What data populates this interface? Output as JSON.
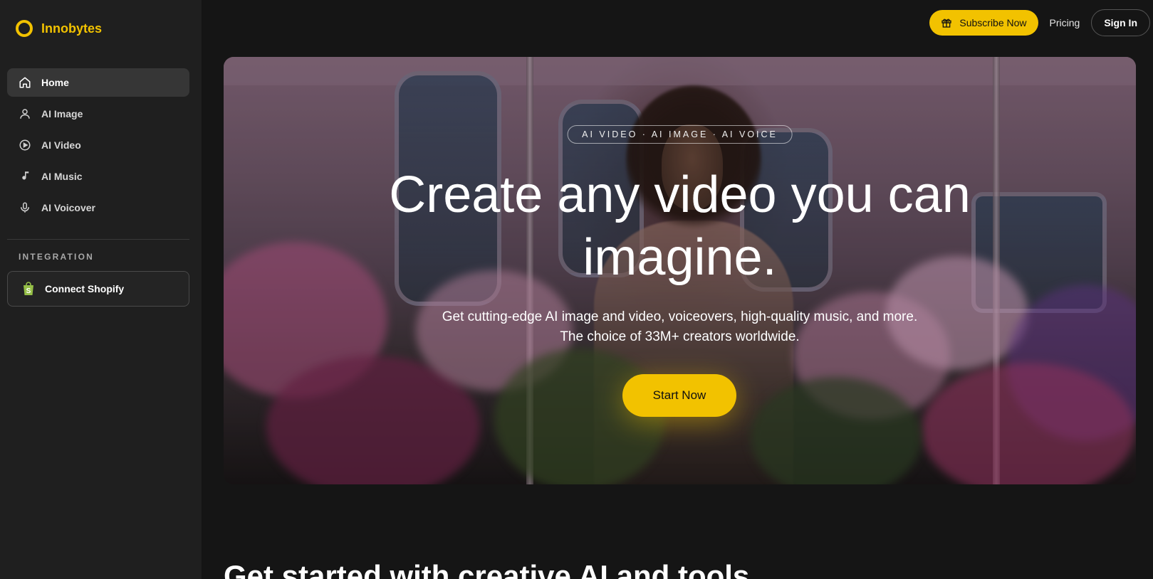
{
  "brand": {
    "name": "Innobytes",
    "accent": "#f2c200"
  },
  "sidebar": {
    "items": [
      {
        "label": "Home",
        "icon": "home-icon",
        "active": true
      },
      {
        "label": "AI Image",
        "icon": "person-icon",
        "active": false
      },
      {
        "label": "AI Video",
        "icon": "play-circle-icon",
        "active": false
      },
      {
        "label": "AI Music",
        "icon": "music-note-icon",
        "active": false
      },
      {
        "label": "AI Voicover",
        "icon": "microphone-icon",
        "active": false
      }
    ],
    "section_label": "INTEGRATION",
    "shopify_label": "Connect Shopify"
  },
  "topbar": {
    "subscribe_label": "Subscribe Now",
    "pricing_label": "Pricing",
    "signin_label": "Sign In"
  },
  "hero": {
    "tagline": "AI VIDEO · AI IMAGE · AI VOICE",
    "headline_line1": "Create any video you can",
    "headline_line2": "imagine.",
    "subtext_line1": "Get cutting-edge AI image and video, voiceovers, high-quality music, and more.",
    "subtext_line2": "The choice of 33M+ creators worldwide.",
    "cta_label": "Start Now"
  },
  "section": {
    "title": "Get started with creative AI and tools"
  }
}
